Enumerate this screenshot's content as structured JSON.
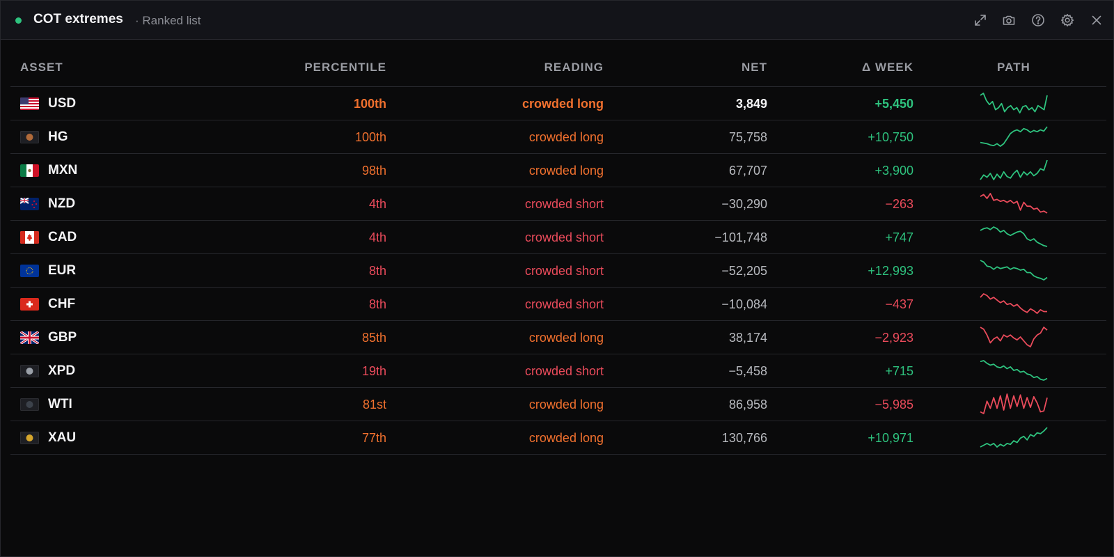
{
  "header": {
    "title": "COT extremes",
    "subtitle": "· Ranked list",
    "status_color": "#2ec27e",
    "icons": [
      "expand-icon",
      "camera-icon",
      "help-icon",
      "gear-icon",
      "close-icon"
    ]
  },
  "columns": {
    "asset": "ASSET",
    "percentile": "PERCENTILE",
    "reading": "READING",
    "net": "NET",
    "week": "Δ WEEK",
    "path": "PATH"
  },
  "colors": {
    "long": "#f0702e",
    "short": "#ea4b5b",
    "positive": "#2ec27e",
    "negative": "#ea4b5b"
  },
  "rows": [
    {
      "asset": "USD",
      "flag": "us",
      "percentile": "100th",
      "reading": "crowded long",
      "net": "3,849",
      "week": "+5,450",
      "side": "long",
      "week_sign": "positive",
      "path": [
        52,
        54,
        47,
        43,
        46,
        38,
        40,
        44,
        36,
        40,
        42,
        38,
        40,
        35,
        41,
        42,
        38,
        40,
        36,
        42,
        40,
        38,
        52
      ]
    },
    {
      "asset": "HG",
      "flag": "hg",
      "percentile": "100th",
      "reading": "crowded long",
      "net": "75,758",
      "week": "+10,750",
      "side": "long",
      "week_sign": "positive",
      "path": [
        30,
        29,
        28,
        26,
        25,
        28,
        24,
        28,
        36,
        44,
        48,
        50,
        47,
        52,
        50,
        46,
        49,
        47,
        50,
        48,
        55
      ]
    },
    {
      "asset": "MXN",
      "flag": "mx",
      "percentile": "98th",
      "reading": "crowded long",
      "net": "67,707",
      "week": "+3,900",
      "side": "long",
      "week_sign": "positive",
      "path": [
        30,
        36,
        33,
        38,
        30,
        37,
        32,
        40,
        34,
        32,
        38,
        42,
        33,
        40,
        36,
        40,
        35,
        38,
        44,
        42,
        55
      ]
    },
    {
      "asset": "NZD",
      "flag": "nz",
      "percentile": "4th",
      "reading": "crowded short",
      "net": "−30,290",
      "week": "−263",
      "side": "short",
      "week_sign": "negative",
      "path": [
        50,
        52,
        48,
        53,
        46,
        47,
        45,
        46,
        44,
        46,
        43,
        45,
        36,
        44,
        40,
        40,
        37,
        38,
        34,
        35,
        33
      ]
    },
    {
      "asset": "CAD",
      "flag": "ca",
      "percentile": "4th",
      "reading": "crowded short",
      "net": "−101,748",
      "week": "+747",
      "side": "short",
      "week_sign": "positive",
      "path": [
        50,
        52,
        53,
        51,
        54,
        52,
        48,
        50,
        46,
        44,
        46,
        48,
        49,
        46,
        40,
        38,
        40,
        36,
        34,
        32,
        31
      ]
    },
    {
      "asset": "EUR",
      "flag": "eu",
      "percentile": "8th",
      "reading": "crowded short",
      "net": "−52,205",
      "week": "+12,993",
      "side": "short",
      "week_sign": "positive",
      "path": [
        55,
        53,
        48,
        47,
        44,
        47,
        45,
        46,
        47,
        44,
        46,
        45,
        43,
        44,
        40,
        40,
        36,
        34,
        33,
        31,
        34
      ]
    },
    {
      "asset": "CHF",
      "flag": "ch",
      "percentile": "8th",
      "reading": "crowded short",
      "net": "−10,084",
      "week": "−437",
      "side": "short",
      "week_sign": "negative",
      "path": [
        48,
        52,
        50,
        46,
        48,
        45,
        42,
        44,
        40,
        41,
        38,
        40,
        36,
        33,
        31,
        35,
        33,
        30,
        34,
        32,
        32
      ]
    },
    {
      "asset": "GBP",
      "flag": "gb",
      "percentile": "85th",
      "reading": "crowded long",
      "net": "38,174",
      "week": "−2,923",
      "side": "long",
      "week_sign": "negative",
      "path": [
        48,
        46,
        40,
        32,
        36,
        38,
        34,
        40,
        38,
        40,
        37,
        35,
        38,
        34,
        30,
        28,
        36,
        40,
        42,
        48,
        45
      ]
    },
    {
      "asset": "XPD",
      "flag": "xpd",
      "percentile": "19th",
      "reading": "crowded short",
      "net": "−5,458",
      "week": "+715",
      "side": "short",
      "week_sign": "positive",
      "path": [
        52,
        53,
        50,
        48,
        49,
        46,
        45,
        47,
        44,
        46,
        42,
        43,
        40,
        41,
        38,
        37,
        34,
        35,
        32,
        31,
        33
      ]
    },
    {
      "asset": "WTI",
      "flag": "wti",
      "percentile": "81st",
      "reading": "crowded long",
      "net": "86,958",
      "week": "−5,985",
      "side": "long",
      "week_sign": "negative",
      "path": [
        30,
        28,
        42,
        34,
        46,
        34,
        48,
        32,
        50,
        34,
        48,
        36,
        49,
        34,
        46,
        35,
        47,
        40,
        30,
        31,
        46
      ]
    },
    {
      "asset": "XAU",
      "flag": "xau",
      "percentile": "77th",
      "reading": "crowded long",
      "net": "130,766",
      "week": "+10,971",
      "side": "long",
      "week_sign": "positive",
      "path": [
        30,
        32,
        34,
        32,
        34,
        30,
        33,
        31,
        34,
        33,
        37,
        35,
        40,
        42,
        38,
        44,
        42,
        46,
        45,
        48,
        52
      ]
    }
  ]
}
